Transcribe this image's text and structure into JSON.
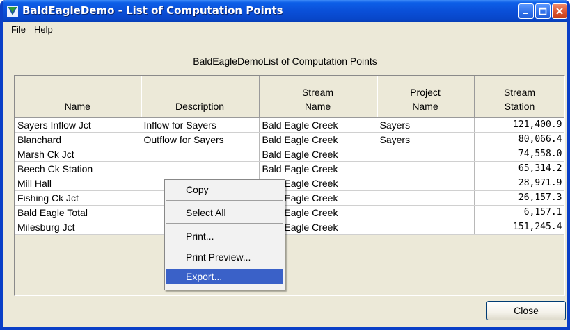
{
  "window": {
    "title": "BaldEagleDemo - List of Computation Points"
  },
  "menubar": {
    "items": [
      "File",
      "Help"
    ]
  },
  "table": {
    "caption": "BaldEagleDemoList of Computation Points",
    "headers": [
      {
        "line1": "",
        "line2": "Name"
      },
      {
        "line1": "",
        "line2": "Description"
      },
      {
        "line1": "Stream",
        "line2": "Name"
      },
      {
        "line1": "Project",
        "line2": "Name"
      },
      {
        "line1": "Stream",
        "line2": "Station"
      }
    ],
    "rows": [
      [
        "Sayers Inflow Jct",
        "Inflow for Sayers",
        "Bald Eagle Creek",
        "Sayers",
        "121,400.9"
      ],
      [
        "Blanchard",
        "Outflow for Sayers",
        "Bald Eagle Creek",
        "Sayers",
        "80,066.4"
      ],
      [
        "Marsh Ck Jct",
        "",
        "Bald Eagle Creek",
        "",
        "74,558.0"
      ],
      [
        "Beech Ck Station",
        "",
        "Bald Eagle Creek",
        "",
        "65,314.2"
      ],
      [
        "Mill Hall",
        "",
        "Bald Eagle Creek",
        "",
        "28,971.9"
      ],
      [
        "Fishing Ck Jct",
        "",
        "Bald Eagle Creek",
        "",
        "26,157.3"
      ],
      [
        "Bald Eagle Total",
        "",
        "Bald Eagle Creek",
        "",
        "6,157.1"
      ],
      [
        "Milesburg Jct",
        "",
        "Bald Eagle Creek",
        "",
        "151,245.4"
      ]
    ]
  },
  "context_menu": {
    "items": [
      {
        "label": "Copy",
        "selected": false
      },
      {
        "label": "Select All",
        "selected": false
      },
      {
        "label": "Print...",
        "selected": false
      },
      {
        "label": "Print Preview...",
        "selected": false
      },
      {
        "label": "Export...",
        "selected": true
      }
    ]
  },
  "buttons": {
    "close_label": "Close"
  },
  "colors": {
    "titlebar": "#0a4fd8",
    "menu_highlight": "#3a61c8",
    "window_bg": "#ece9d8"
  }
}
